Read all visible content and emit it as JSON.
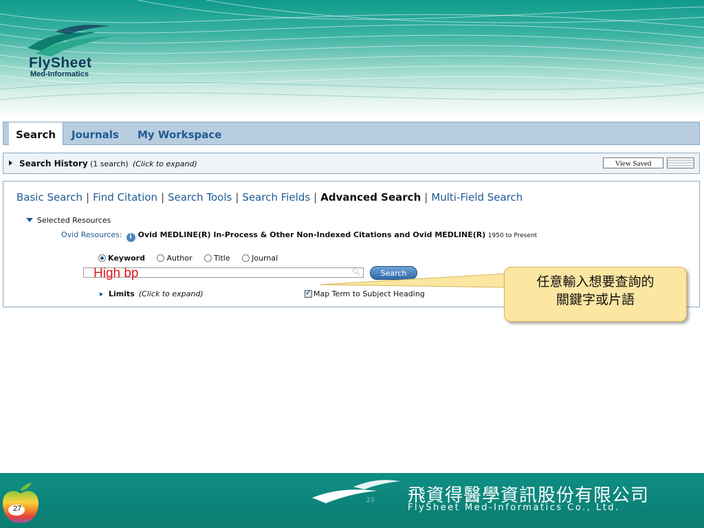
{
  "brand": {
    "logo_name": "FlySheet",
    "logo_sub": "Med-Informatics"
  },
  "tabs": [
    {
      "label": "Search",
      "active": true
    },
    {
      "label": "Journals",
      "active": false
    },
    {
      "label": "My Workspace",
      "active": false
    }
  ],
  "history": {
    "title": "Search History",
    "count": "(1 search)",
    "hint": "(Click to expand)",
    "view_saved": "View Saved"
  },
  "search_modes": [
    {
      "label": "Basic Search",
      "current": false
    },
    {
      "label": "Find Citation",
      "current": false
    },
    {
      "label": "Search Tools",
      "current": false
    },
    {
      "label": "Search Fields",
      "current": false
    },
    {
      "label": "Advanced Search",
      "current": true
    },
    {
      "label": "Multi-Field Search",
      "current": false
    }
  ],
  "resources": {
    "selected_label": "Selected Resources",
    "ovid_label": "Ovid Resources:",
    "info_icon_glyph": "i",
    "resource_name": "Ovid MEDLINE(R) In-Process & Other Non-Indexed Citations and Ovid MEDLINE(R)",
    "resource_years": "1950 to Present"
  },
  "search_types": [
    {
      "label": "Keyword",
      "selected": true
    },
    {
      "label": "Author",
      "selected": false
    },
    {
      "label": "Title",
      "selected": false
    },
    {
      "label": "Journal",
      "selected": false
    }
  ],
  "query": {
    "value": "High bp",
    "button": "Search"
  },
  "limits": {
    "label": "Limits",
    "hint": "(Click to expand)",
    "map_term": "Map Term to Subject Heading",
    "map_term_checked": true
  },
  "callout": {
    "line1": "任意輸入想要查詢的",
    "line2": "關鍵字或片語"
  },
  "footer": {
    "page_number": "27",
    "small_number": "23",
    "company_zh": "飛資得醫學資訊股份有限公司",
    "company_en": "FlySheet Med-Informatics Co., Ltd."
  },
  "colors": {
    "teal": "#0b7c71",
    "link_blue": "#1f5a93",
    "query_red": "#e0181c",
    "callout_fill": "#fbe6a2"
  },
  "icons": [
    "search-icon",
    "info-icon",
    "grid-icon",
    "apple-logo-icon",
    "flysheet-wave-logo-icon"
  ]
}
